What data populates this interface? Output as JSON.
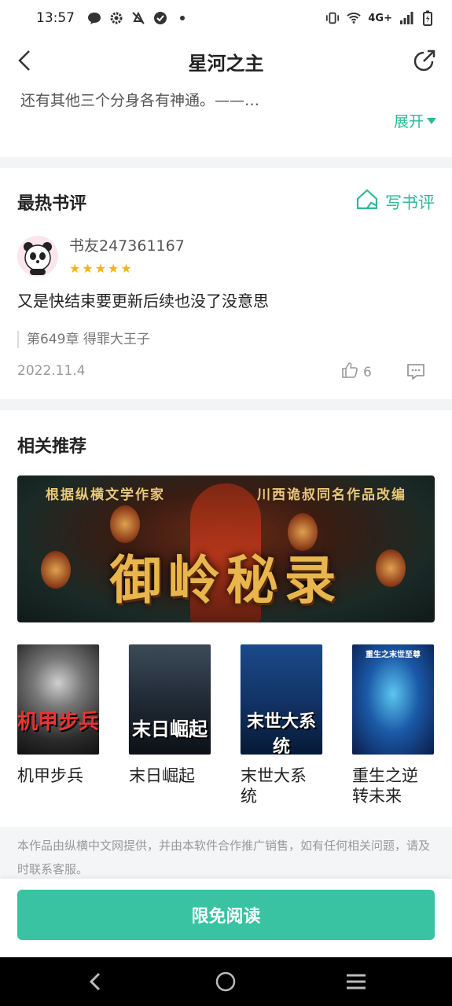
{
  "status_bar": {
    "time": "13:57",
    "network": "4G+",
    "left_icons": [
      "message-icon",
      "gear-icon",
      "mute-icon",
      "check-icon",
      "dot-icon"
    ],
    "right_icons": [
      "vibrate-icon",
      "wifi-icon",
      "signal-icon",
      "battery-icon"
    ]
  },
  "navbar": {
    "title": "星河之主",
    "back_icon": "back-arrow-icon",
    "share_icon": "share-icon"
  },
  "intro": {
    "text": "还有其他三个分身各有神通。——…",
    "expand_label": "展开"
  },
  "reviews": {
    "section_title": "最热书评",
    "write_label": "写书评",
    "items": [
      {
        "username": "书友247361167",
        "rating": 5,
        "text": "又是快结束要更新后续也没了没意思",
        "chapter": "第649章 得罪大王子",
        "date": "2022.11.4",
        "likes": "6"
      }
    ]
  },
  "recommend": {
    "section_title": "相关推荐",
    "banner": {
      "tagline_left": "根据纵横文学作家",
      "tagline_right": "川西诡叔同名作品改编",
      "title": "御岭秘录",
      "lantern_char": "奠"
    },
    "books": [
      {
        "name": "机甲步兵",
        "cover_title": "机甲步兵"
      },
      {
        "name": "末日崛起",
        "cover_title": "末日崛起"
      },
      {
        "name": "末世大系统",
        "cover_title": "末世大系统"
      },
      {
        "name": "重生之逆转未来",
        "cover_title": "重生之末世至尊"
      }
    ]
  },
  "footer": {
    "note": "本作品由纵横中文网提供，并由本软件合作推广销售，如有任何相关问题，请及时联系客服。",
    "cta_label": "限免阅读"
  },
  "colors": {
    "accent": "#2fb89a",
    "cta": "#39c3a3",
    "star": "#f6b21b",
    "divider": "#f2f4f5"
  }
}
